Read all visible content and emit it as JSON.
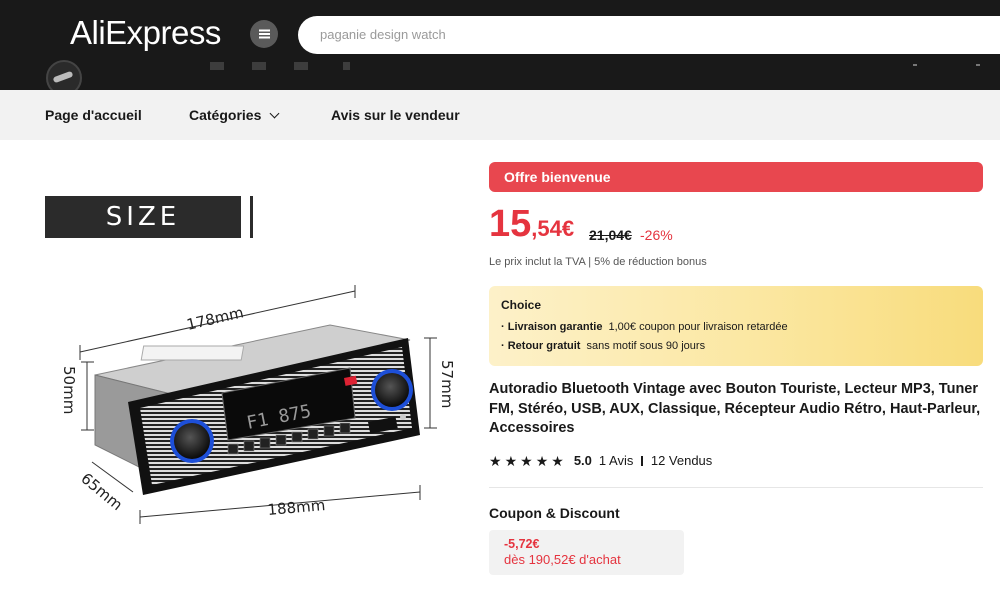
{
  "header": {
    "logo": "AliExpress",
    "search_placeholder": "paganie design watch"
  },
  "nav": {
    "items": [
      {
        "label": "Page d'accueil"
      },
      {
        "label": "Catégories"
      },
      {
        "label": "Avis sur le vendeur"
      }
    ]
  },
  "gallery": {
    "size_label": "SIZE",
    "dims": {
      "width_top": "178mm",
      "width_bottom": "188mm",
      "height_left": "50mm",
      "height_right": "57mm",
      "depth": "65mm"
    },
    "display_text": "F1 875"
  },
  "product": {
    "welcome_badge": "Offre bienvenue",
    "price_int": "15",
    "price_dec": ",54€",
    "old_price": "21,04€",
    "discount": "-26%",
    "tax_note": "Le prix inclut la TVA | 5% de réduction bonus",
    "choice": {
      "title": "Choice",
      "line1_bold": "· Livraison garantie",
      "line1_text": "1,00€ coupon pour livraison retardée",
      "line2_bold": "· Retour gratuit",
      "line2_text": "sans motif sous 90 jours"
    },
    "title": "Autoradio Bluetooth Vintage avec Bouton Touriste, Lecteur MP3, Tuner FM, Stéréo, USB, AUX, Classique, Récepteur Audio Rétro, Haut-Parleur, Accessoires",
    "rating": {
      "score": "5.0",
      "stars": 5,
      "reviews": "1 Avis",
      "sold": "12 Vendus"
    },
    "coupon_section": {
      "title": "Coupon & Discount",
      "amount": "-5,72€",
      "condition": "dès 190,52€ d'achat"
    }
  },
  "colors": {
    "accent_red": "#e5343f",
    "header_bg": "#191919",
    "choice_bg": "#fbe7a1"
  }
}
